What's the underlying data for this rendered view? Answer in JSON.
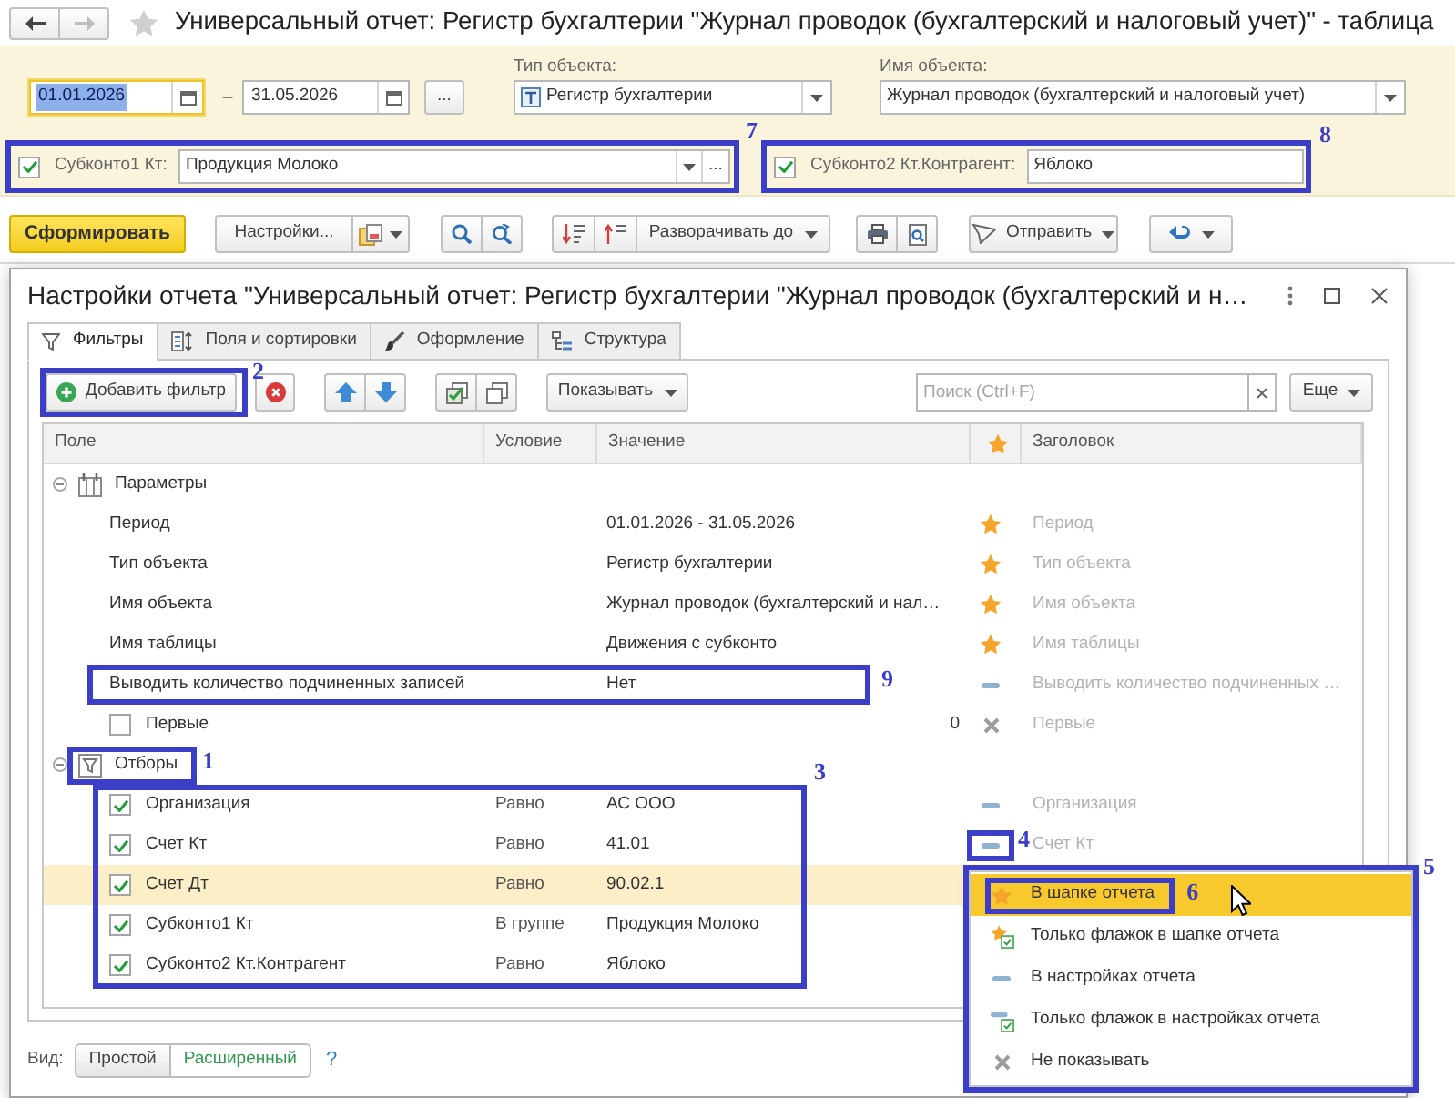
{
  "window": {
    "title": "Универсальный отчет: Регистр бухгалтерии \"Журнал проводок (бухгалтерский и налоговый учет)\" - таблица",
    "favorite": false,
    "back_disabled": false,
    "forward_disabled": true
  },
  "header": {
    "period": {
      "start": "01.01.2026",
      "start_focused": true,
      "separator": "–",
      "end": "31.05.2026",
      "more": "..."
    },
    "object_type": {
      "label": "Тип объекта:",
      "value": "Регистр бухгалтерии"
    },
    "object_name": {
      "label": "Имя объекта:",
      "value": "Журнал проводок (бухгалтерский и налоговый учет)"
    },
    "quick_filters": [
      {
        "kind": "choice",
        "checked": true,
        "label": "Субконто1 Кт:",
        "value": "Продукция Молоко",
        "more": "...",
        "callout": "7"
      },
      {
        "kind": "text",
        "checked": true,
        "label": "Субконто2 Кт.Контрагент:",
        "value": "Яблоко",
        "callout": "8"
      }
    ]
  },
  "toolbar": {
    "generate": "Сформировать",
    "settings": "Настройки...",
    "expand": "Разворачивать до",
    "send": "Отправить"
  },
  "dialog": {
    "title": "Настройки отчета \"Универсальный отчет: Регистр бухгалтерии \"Журнал проводок (бухгалтерский и н…",
    "tabs": [
      {
        "kind": "filters",
        "label": "Фильтры",
        "selected": true
      },
      {
        "kind": "fields",
        "label": "Поля и сортировки",
        "selected": false
      },
      {
        "kind": "appearance",
        "label": "Оформление",
        "selected": false
      },
      {
        "kind": "structure",
        "label": "Структура",
        "selected": false
      }
    ],
    "toolbar": {
      "add_filter": "Добавить фильтр",
      "add_filter_callout": "2",
      "show": "Показывать",
      "search_placeholder": "Поиск (Ctrl+F)",
      "more": "Еще"
    },
    "table": {
      "columns": [
        {
          "kind": "text",
          "label": "Поле"
        },
        {
          "kind": "text",
          "label": "Условие"
        },
        {
          "kind": "text",
          "label": "Значение"
        },
        {
          "kind": "star"
        },
        {
          "kind": "text",
          "label": "Заголовок"
        }
      ],
      "groups": [
        {
          "kind": "parameters",
          "label": "Параметры",
          "expanded": true,
          "rows": [
            {
              "kind": "plain",
              "field": "Период",
              "value": "01.01.2026 - 31.05.2026",
              "marker": {
                "kind": "star"
              },
              "title": "Период",
              "selected": false
            },
            {
              "kind": "plain",
              "field": "Тип объекта",
              "value": "Регистр бухгалтерии",
              "marker": {
                "kind": "star"
              },
              "title": "Тип объекта",
              "selected": false
            },
            {
              "kind": "plain",
              "field": "Имя объекта",
              "value": "Журнал проводок (бухгалтерский и нал…",
              "marker": {
                "kind": "star"
              },
              "title": "Имя объекта",
              "selected": false
            },
            {
              "kind": "plain",
              "field": "Имя таблицы",
              "value": "Движения с субконто",
              "marker": {
                "kind": "star"
              },
              "title": "Имя таблицы",
              "selected": false
            },
            {
              "kind": "plain",
              "field": "Выводить количество подчиненных записей",
              "value": "Нет",
              "marker": {
                "kind": "dash"
              },
              "title": "Выводить количество подчиненных …",
              "selected": false,
              "callout": "9"
            },
            {
              "kind": "check-number",
              "checked": false,
              "field": "Первые",
              "value": "0",
              "marker": {
                "kind": "cross"
              },
              "title": "Первые",
              "selected": false
            }
          ]
        },
        {
          "kind": "filters",
          "label": "Отборы",
          "expanded": true,
          "callout": "1",
          "rows_callout": "3",
          "rows": [
            {
              "kind": "check",
              "checked": true,
              "field": "Организация",
              "condition": "Равно",
              "value": "АС ООО",
              "marker": {
                "kind": "dash"
              },
              "title": "Организация",
              "selected": false
            },
            {
              "kind": "check",
              "checked": true,
              "field": "Счет Кт",
              "condition": "Равно",
              "value": "41.01",
              "marker": {
                "kind": "dash",
                "callout": "4"
              },
              "title": "Счет Кт",
              "selected": false
            },
            {
              "kind": "check",
              "checked": true,
              "field": "Счет Дт",
              "condition": "Равно",
              "value": "90.02.1",
              "selected": true
            },
            {
              "kind": "check",
              "checked": true,
              "field": "Субконто1 Кт",
              "condition": "В группе",
              "value": "Продукция Молоко",
              "selected": false
            },
            {
              "kind": "check",
              "checked": true,
              "field": "Субконто2 Кт.Контрагент",
              "condition": "Равно",
              "value": "Яблоко",
              "selected": false
            }
          ]
        }
      ]
    },
    "menu": {
      "callout": "5",
      "items": [
        {
          "kind": "star",
          "label": "В шапке отчета",
          "selected": true,
          "callout": "6"
        },
        {
          "kind": "star-check",
          "label": "Только флажок в шапке отчета",
          "selected": false
        },
        {
          "kind": "dash",
          "label": "В настройках отчета",
          "selected": false
        },
        {
          "kind": "dash-check",
          "label": "Только флажок в настройках отчета",
          "selected": false
        },
        {
          "kind": "cross",
          "label": "Не показывать",
          "selected": false
        }
      ]
    },
    "view": {
      "label": "Вид:",
      "options": [
        {
          "label": "Простой",
          "selected": false
        },
        {
          "label": "Расширенный",
          "selected": true
        }
      ],
      "help": "?"
    }
  }
}
